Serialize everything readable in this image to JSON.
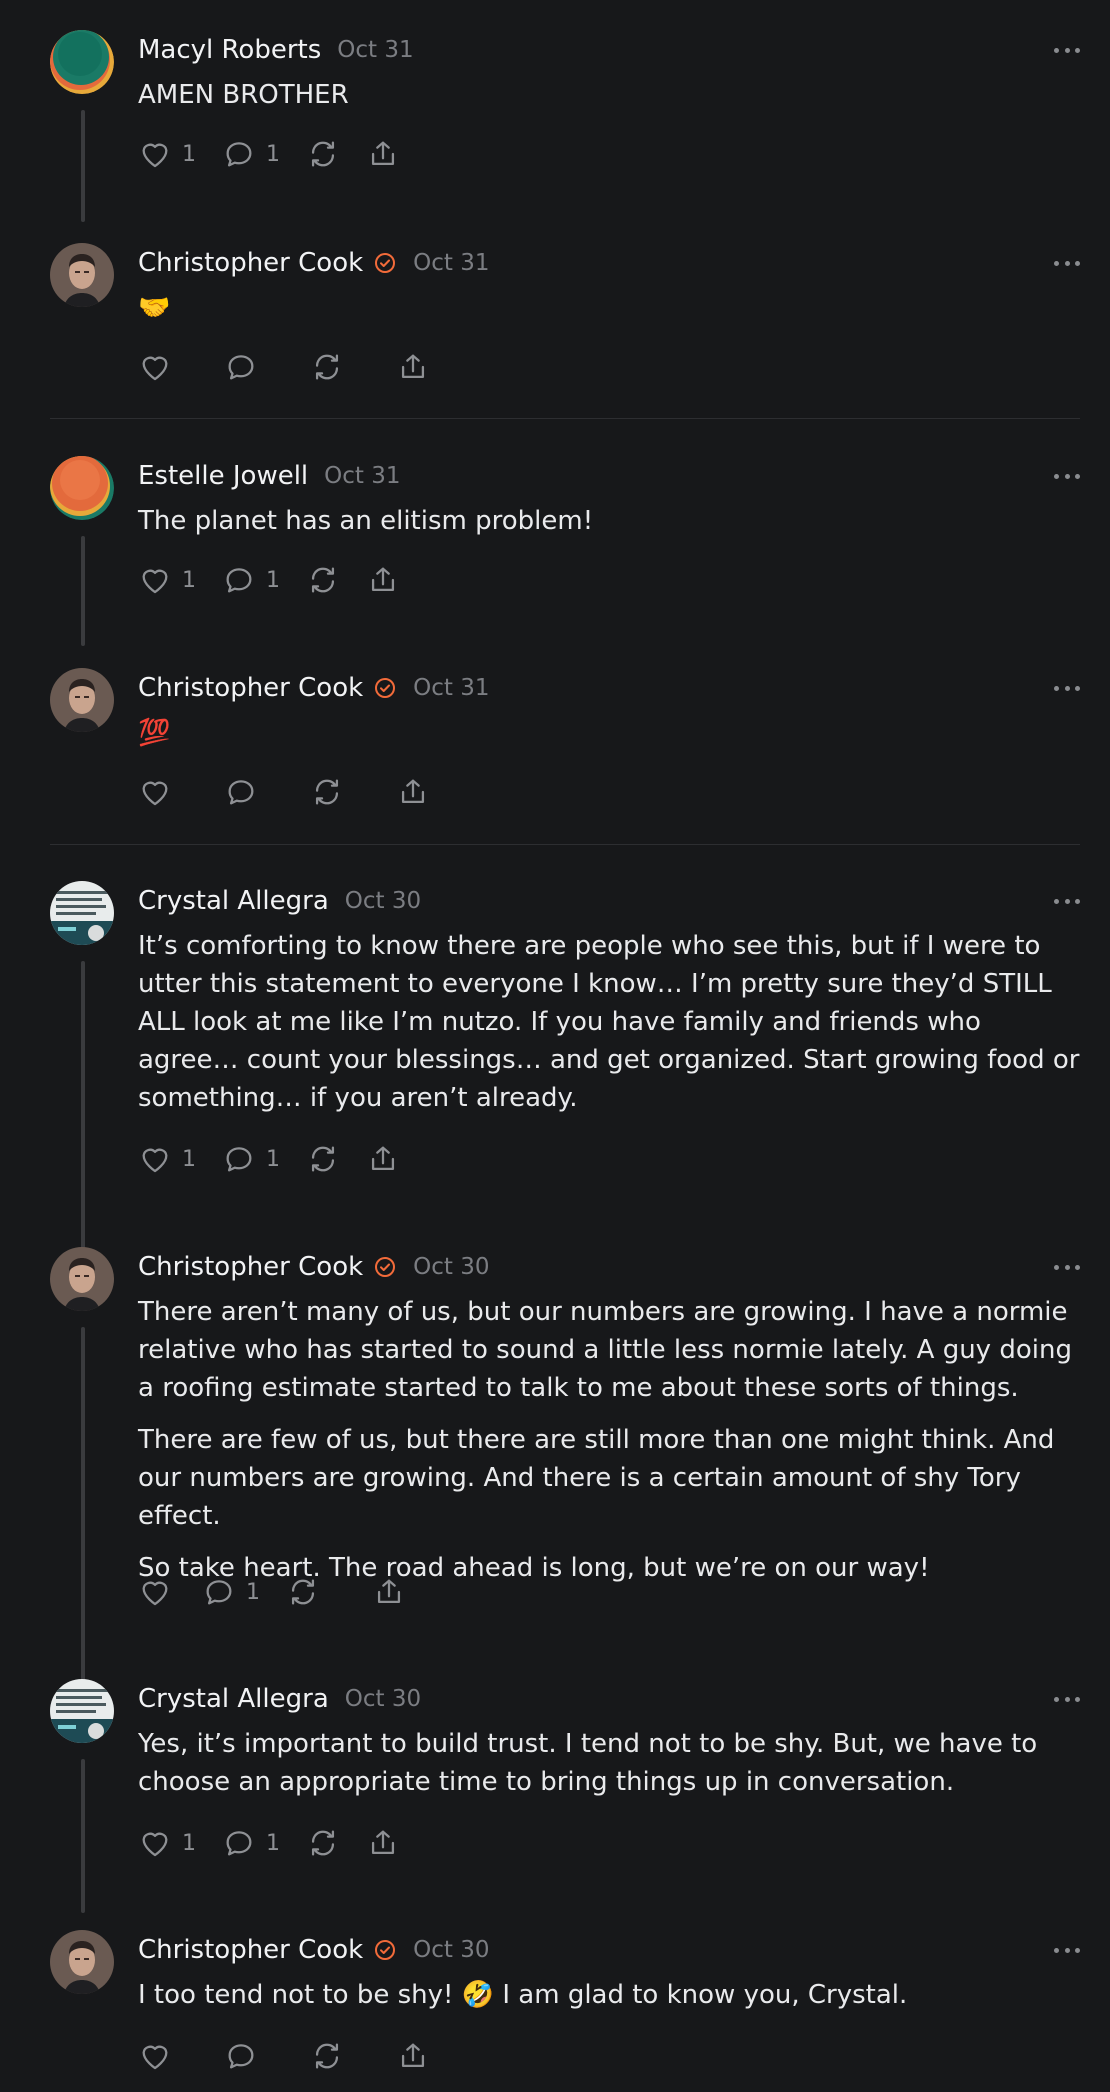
{
  "colors": {
    "background": "#17181a",
    "verified": "#f26b3a",
    "icon": "#8e9094",
    "thread_line": "#3a3b3e"
  },
  "icons": [
    "heart-icon",
    "comment-icon",
    "repost-icon",
    "share-icon",
    "more-icon",
    "verified-icon"
  ],
  "posts": [
    {
      "author": "Macyl Roberts",
      "date": "Oct 31",
      "verified": false,
      "text": [
        "AMEN BROTHER"
      ],
      "likes": "1",
      "comments": "1"
    },
    {
      "author": "Christopher Cook",
      "date": "Oct 31",
      "verified": true,
      "text": [
        "🤝"
      ],
      "likes": "",
      "comments": ""
    },
    {
      "author": "Estelle Jowell",
      "date": "Oct 31",
      "verified": false,
      "text": [
        "The planet has an elitism problem!"
      ],
      "likes": "1",
      "comments": "1"
    },
    {
      "author": "Christopher Cook",
      "date": "Oct 31",
      "verified": true,
      "text": [
        "💯"
      ],
      "likes": "",
      "comments": ""
    },
    {
      "author": "Crystal Allegra",
      "date": "Oct 30",
      "verified": false,
      "text": [
        "It’s comforting to know there are people who see this, but if I were to utter this statement to everyone I know… I’m pretty sure they’d STILL ALL look at me like I’m nutzo. If you have family and friends who agree… count your blessings… and get organized. Start growing food or something… if you aren’t already."
      ],
      "likes": "1",
      "comments": "1"
    },
    {
      "author": "Christopher Cook",
      "date": "Oct 30",
      "verified": true,
      "text": [
        "There aren’t many of us, but our numbers are growing. I have a normie relative who has started to sound a little less normie lately. A guy doing a roofing estimate started to talk to me about these sorts of things.",
        "There are few of us, but there are still more than one might think. And our numbers are growing. And there is a certain amount of shy Tory effect.",
        "So take heart. The road ahead is long, but we’re on our way!"
      ],
      "likes": "",
      "comments": "1"
    },
    {
      "author": "Crystal Allegra",
      "date": "Oct 30",
      "verified": false,
      "text": [
        "Yes, it’s important to build trust. I tend not to be shy. But, we have to choose an appropriate time to bring things up in conversation."
      ],
      "likes": "1",
      "comments": "1"
    },
    {
      "author": "Christopher Cook",
      "date": "Oct 30",
      "verified": true,
      "text": [
        "I too tend not to be shy! 🤣 I am glad to know you, Crystal."
      ],
      "likes": "",
      "comments": ""
    }
  ]
}
